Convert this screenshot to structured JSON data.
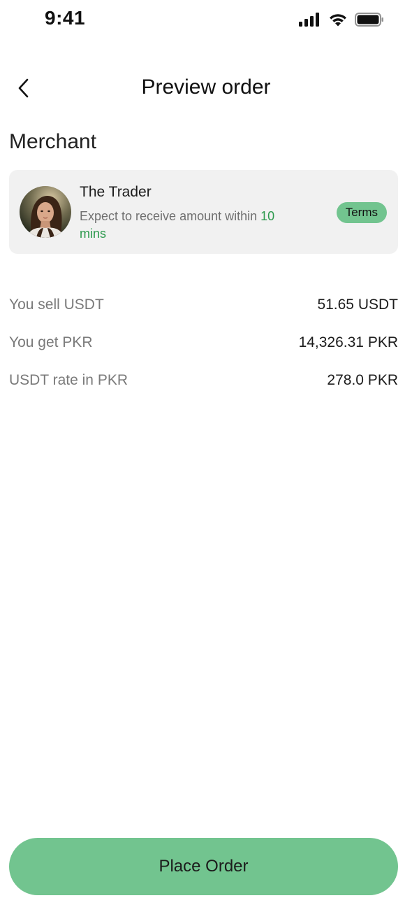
{
  "status_bar": {
    "time": "9:41",
    "icons": [
      "signal-icon",
      "wifi-icon",
      "battery-icon"
    ]
  },
  "header": {
    "back_icon": "chevron-left-icon",
    "title": "Preview order"
  },
  "merchant_section": {
    "title": "Merchant",
    "merchant": {
      "name": "The Trader",
      "description_prefix": "Expect to receive amount within",
      "eta": "10 mins",
      "terms_label": "Terms",
      "avatar": "avatar-photo"
    }
  },
  "summary": {
    "rows": [
      {
        "label": "You sell USDT",
        "value": "51.65 USDT"
      },
      {
        "label": "You get PKR",
        "value": "14,326.31 PKR"
      },
      {
        "label": "USDT rate in PKR",
        "value": "278.0 PKR"
      }
    ]
  },
  "actions": {
    "place_order_label": "Place Order"
  },
  "colors": {
    "accent": "#72c48f",
    "eta_text": "#2e9a4e",
    "card_bg": "#f1f1f1",
    "muted_text": "#7a7a7a"
  }
}
